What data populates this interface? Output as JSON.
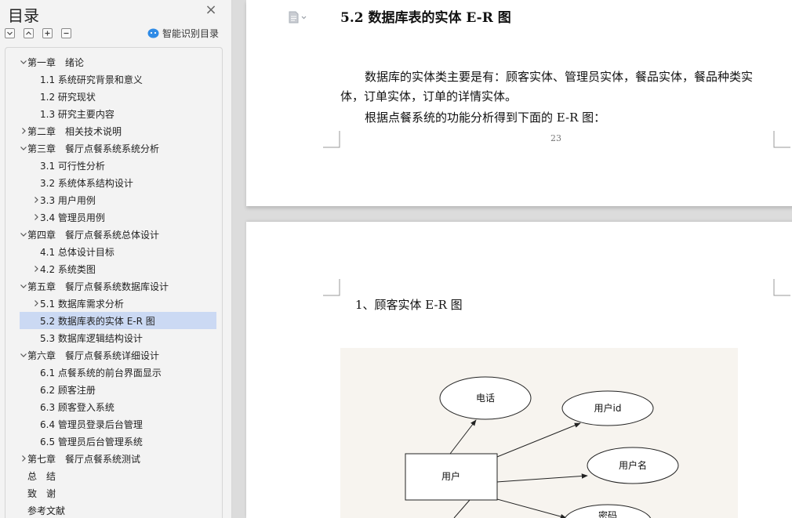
{
  "toc": {
    "title": "目录",
    "close_icon": "close-icon",
    "tools": [
      "collapse-all-icon",
      "expand-icon",
      "add-level-icon",
      "remove-level-icon"
    ],
    "smart_toc_label": "智能识别目录",
    "items": [
      {
        "label": "第一章　绪论",
        "level": 1,
        "chevron": "down",
        "selected": false
      },
      {
        "label": "1.1 系统研究背景和意义",
        "level": 2,
        "chevron": "none",
        "selected": false
      },
      {
        "label": "1.2 研究现状",
        "level": 2,
        "chevron": "none",
        "selected": false
      },
      {
        "label": "1.3 研究主要内容",
        "level": 2,
        "chevron": "none",
        "selected": false
      },
      {
        "label": "第二章　相关技术说明",
        "level": 1,
        "chevron": "right",
        "selected": false
      },
      {
        "label": "第三章　餐厅点餐系统系统分析",
        "level": 1,
        "chevron": "down",
        "selected": false
      },
      {
        "label": "3.1 可行性分析",
        "level": 2,
        "chevron": "none",
        "selected": false
      },
      {
        "label": "3.2 系统体系结构设计",
        "level": 2,
        "chevron": "none",
        "selected": false
      },
      {
        "label": "3.3 用户用例",
        "level": 2,
        "chevron": "right",
        "selected": false
      },
      {
        "label": "3.4 管理员用例",
        "level": 2,
        "chevron": "right",
        "selected": false
      },
      {
        "label": "第四章　餐厅点餐系统总体设计",
        "level": 1,
        "chevron": "down",
        "selected": false
      },
      {
        "label": "4.1 总体设计目标",
        "level": 2,
        "chevron": "none",
        "selected": false
      },
      {
        "label": "4.2 系统类图",
        "level": 2,
        "chevron": "right",
        "selected": false
      },
      {
        "label": "第五章　餐厅点餐系统数据库设计",
        "level": 1,
        "chevron": "down",
        "selected": false
      },
      {
        "label": "5.1 数据库需求分析",
        "level": 2,
        "chevron": "right",
        "selected": false
      },
      {
        "label": "5.2  数据库表的实体 E-R 图",
        "level": 2,
        "chevron": "none",
        "selected": true
      },
      {
        "label": "5.3  数据库逻辑结构设计",
        "level": 2,
        "chevron": "none",
        "selected": false
      },
      {
        "label": "第六章　餐厅点餐系统详细设计",
        "level": 1,
        "chevron": "down",
        "selected": false
      },
      {
        "label": "6.1  点餐系统的前台界面显示",
        "level": 2,
        "chevron": "none",
        "selected": false
      },
      {
        "label": "6.2 顾客注册",
        "level": 2,
        "chevron": "none",
        "selected": false
      },
      {
        "label": "6.3 顾客登入系统",
        "level": 2,
        "chevron": "none",
        "selected": false
      },
      {
        "label": "6.4 管理员登录后台管理",
        "level": 2,
        "chevron": "none",
        "selected": false
      },
      {
        "label": "6.5 管理员后台管理系统",
        "level": 2,
        "chevron": "none",
        "selected": false
      },
      {
        "label": "第七章　餐厅点餐系统测试",
        "level": 1,
        "chevron": "right",
        "selected": false
      },
      {
        "label": "总　结",
        "level": 1,
        "chevron": "none",
        "selected": false
      },
      {
        "label": "致　谢",
        "level": 1,
        "chevron": "none",
        "selected": false
      },
      {
        "label": "参考文献",
        "level": 1,
        "chevron": "none",
        "selected": false
      }
    ]
  },
  "document": {
    "heading": "5.2  数据库表的实体 E-R 图",
    "heading_icon": "document-style-icon",
    "para1_line1": "数据库的实体类主要是有：顾客实体、管理员实体，餐品实体，餐品种类实",
    "para1_line2": "体，订单实体，订单的详情实体。",
    "para2": "根据点餐系统的功能分析得到下面的 E-R 图：",
    "page_number": "23",
    "sub_heading": "1、顾客实体 E-R 图",
    "er": {
      "entity": "用户",
      "attr_phone": "电话",
      "attr_user_id": "用户id",
      "attr_username": "用户名",
      "attr_password_partial": "密码"
    }
  },
  "colors": {
    "selected_bg": "#cbd9f3",
    "sidebar_bg": "#f3f3f3",
    "workspace_bg": "#dcdcdc",
    "smart_icon": "#2f8be6"
  }
}
